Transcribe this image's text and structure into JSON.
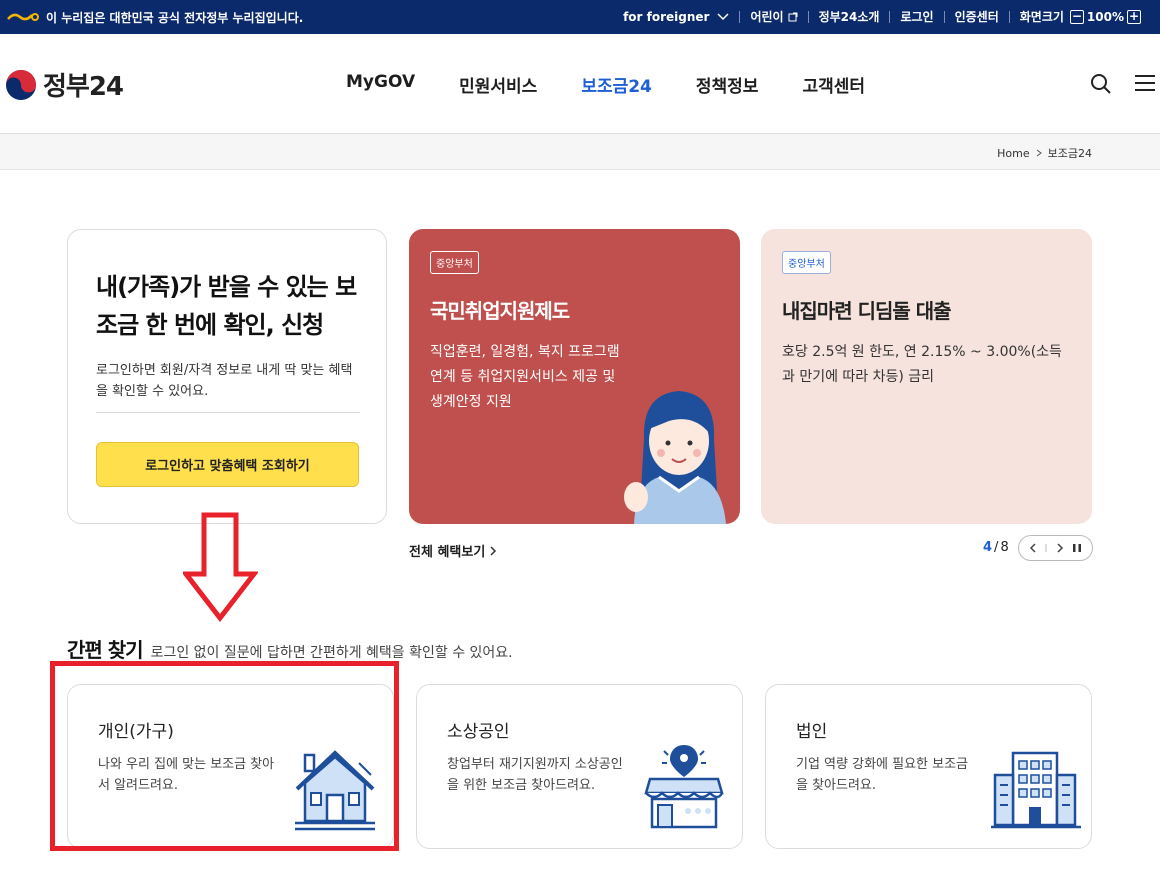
{
  "topbar": {
    "notice": "이 누리집은 대한민국 공식 전자정부 누리집입니다.",
    "links": [
      "for foreigner",
      "어린이",
      "정부24소개",
      "로그인",
      "인증센터"
    ],
    "zoom_label": "화면크기",
    "zoom_value": "100%"
  },
  "header": {
    "logo": "정부24",
    "nav": [
      "MyGOV",
      "민원서비스",
      "보조금24",
      "정책정보",
      "고객센터"
    ],
    "active_nav": "보조금24"
  },
  "breadcrumb": [
    "Home",
    "보조금24"
  ],
  "login_card": {
    "title": "내(가족)가 받을 수 있는 보조금 한 번에 확인, 신청",
    "desc": "로그인하면 회원/자격 정보로 내게 딱 맞는 혜택을 확인할 수 있어요.",
    "button": "로그인하고 맞춤혜택 조회하기"
  },
  "slides": [
    {
      "badge": "중앙부처",
      "title": "국민취업지원제도",
      "desc": "직업훈련, 일경험, 복지 프로그램 연계 등 취업지원서비스 제공 및 생계안정 지원"
    },
    {
      "badge": "중앙부처",
      "title": "내집마련 디딤돌 대출",
      "desc": "호당 2.5억 원 한도, 연 2.15% ~ 3.00%(소득과 만기에 따라 차등) 금리"
    }
  ],
  "carousel": {
    "all_link": "전체 혜택보기",
    "current": "4",
    "total": "8"
  },
  "quick_search": {
    "title": "간편 찾기",
    "subtitle": "로그인 없이 질문에 답하면 간편하게 혜택을 확인할 수 있어요.",
    "cards": [
      {
        "title": "개인(가구)",
        "desc": "나와 우리 집에 맞는 보조금 찾아서 알려드려요.",
        "icon": "house-icon"
      },
      {
        "title": "소상공인",
        "desc": "창업부터 재기지원까지 소상공인을 위한 보조금 찾아드려요.",
        "icon": "store-icon"
      },
      {
        "title": "법인",
        "desc": "기업 역량 강화에 필요한 보조금을 찾아드려요.",
        "icon": "building-icon"
      }
    ]
  },
  "colors": {
    "topbar": "#0b2a6b",
    "accent": "#1e5fd3",
    "red_card": "#c0504d",
    "pink_card": "#f6e3dd",
    "yellow_button": "#ffdf4c",
    "highlight": "#e8212a"
  }
}
